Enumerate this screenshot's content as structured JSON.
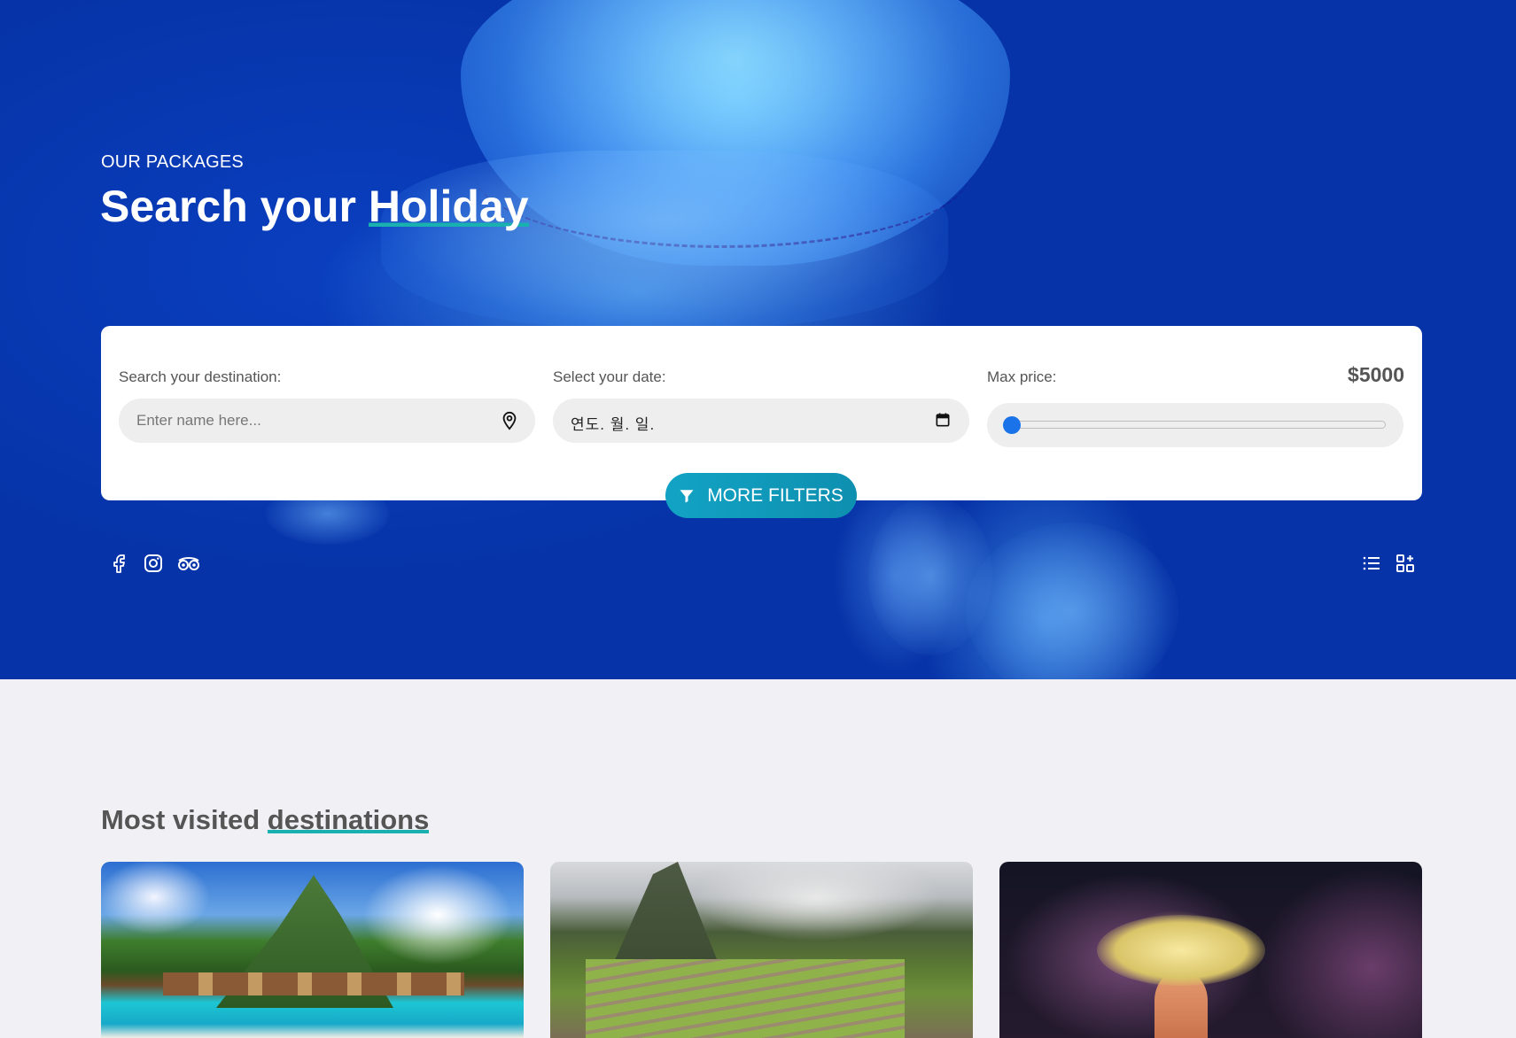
{
  "hero": {
    "eyebrow": "OUR PACKAGES",
    "title_lead": "Search your ",
    "title_highlight": "Holiday"
  },
  "search": {
    "destination_label": "Search your destination:",
    "destination_placeholder": "Enter name here...",
    "date_label": "Select your date:",
    "date_value": "연도. 월. 일.",
    "price_label": "Max price:",
    "price_value": "$5000",
    "price_slider_fraction": 0,
    "more_filters_label": "MORE FILTERS"
  },
  "icons": {
    "social": [
      "facebook-icon",
      "instagram-icon",
      "tripadvisor-icon"
    ],
    "view": [
      "list-view-icon",
      "grid-view-icon"
    ],
    "destination_field": "location-pin-icon",
    "date_field": "calendar-icon",
    "filters": "filter-icon"
  },
  "colors": {
    "hero_blue": "#0633a8",
    "accent_teal": "#19b0b0",
    "button_teal": "#12a3c4",
    "slider_blue": "#1a73e8",
    "page_bg": "#f0f0f5"
  },
  "section": {
    "title_lead": "Most visited ",
    "title_highlight": "destinations"
  },
  "cards": [
    {
      "image": "tropical-island-bungalows"
    },
    {
      "image": "mountain-ruins-terraces"
    },
    {
      "image": "coral-reef"
    }
  ]
}
